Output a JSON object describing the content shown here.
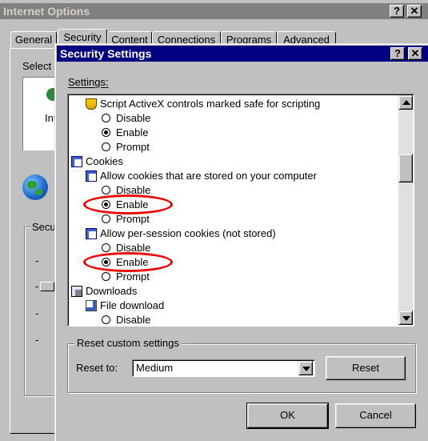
{
  "back_window": {
    "title": "Internet Options",
    "help_glyph": "?",
    "close_glyph": "✕",
    "tabs": [
      "General",
      "Security",
      "Content",
      "Connections",
      "Programs",
      "Advanced"
    ],
    "select_text": "Select",
    "zone_text": "Int",
    "security_level_text": "Secu"
  },
  "dialog": {
    "title": "Security Settings",
    "help_glyph": "?",
    "close_glyph": "✕",
    "settings_label": "Settings:",
    "items": [
      {
        "kind": "group",
        "icon": "activex-shield-icon",
        "label": "Script ActiveX controls marked safe for scripting"
      },
      {
        "kind": "radio",
        "label": "Disable",
        "checked": false
      },
      {
        "kind": "radio",
        "label": "Enable",
        "checked": true
      },
      {
        "kind": "radio",
        "label": "Prompt",
        "checked": false
      },
      {
        "kind": "category",
        "icon": "cookies-icon",
        "label": "Cookies"
      },
      {
        "kind": "group",
        "icon": "cookie-setting-icon",
        "label": "Allow cookies that are stored on your computer"
      },
      {
        "kind": "radio",
        "label": "Disable",
        "checked": false
      },
      {
        "kind": "radio",
        "label": "Enable",
        "checked": true
      },
      {
        "kind": "radio",
        "label": "Prompt",
        "checked": false
      },
      {
        "kind": "group",
        "icon": "cookie-setting-icon",
        "label": "Allow per-session cookies (not stored)"
      },
      {
        "kind": "radio",
        "label": "Disable",
        "checked": false
      },
      {
        "kind": "radio",
        "label": "Enable",
        "checked": true
      },
      {
        "kind": "radio",
        "label": "Prompt",
        "checked": false
      },
      {
        "kind": "category",
        "icon": "downloads-icon",
        "label": "Downloads"
      },
      {
        "kind": "group",
        "icon": "file-download-icon",
        "label": "File download"
      },
      {
        "kind": "radio",
        "label": "Disable",
        "checked": false
      }
    ],
    "reset_group_label": "Reset custom settings",
    "reset_to_label": "Reset to:",
    "reset_value": "Medium",
    "reset_button": "Reset",
    "ok_button": "OK",
    "cancel_button": "Cancel",
    "highlight_color": "#e00000"
  },
  "colors": {
    "title_active": "#000080",
    "title_inactive": "#808080",
    "face": "#c0c0c0"
  }
}
